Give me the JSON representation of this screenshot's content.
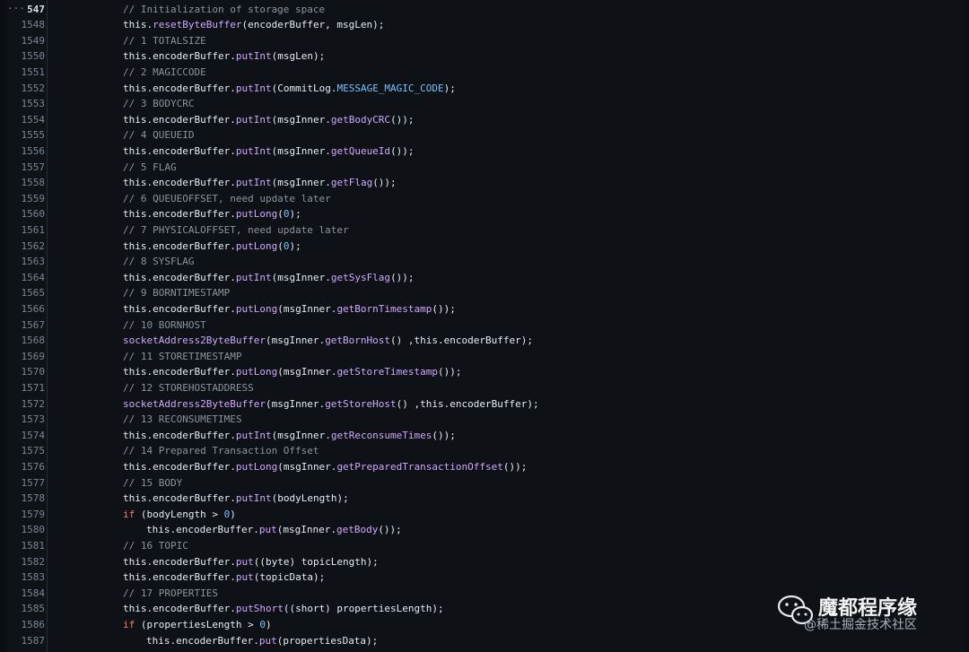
{
  "editor": {
    "fold_indicator": "···",
    "line_numbers": [
      "547",
      "1548",
      "1549",
      "1550",
      "1551",
      "1552",
      "1553",
      "1554",
      "1555",
      "1556",
      "1557",
      "1558",
      "1559",
      "1560",
      "1561",
      "1562",
      "1563",
      "1564",
      "1565",
      "1566",
      "1567",
      "1568",
      "1569",
      "1570",
      "1571",
      "1572",
      "1573",
      "1574",
      "1575",
      "1576",
      "1577",
      "1578",
      "1579",
      "1580",
      "1581",
      "1582",
      "1583",
      "1584",
      "1585",
      "1586",
      "1587"
    ],
    "active_line": "547",
    "lines": [
      {
        "indent": 0,
        "tokens": [
          {
            "t": "// Initialization of storage space",
            "c": "comment"
          }
        ]
      },
      {
        "indent": 0,
        "tokens": [
          {
            "t": "this.",
            "c": "plain"
          },
          {
            "t": "resetByteBuffer",
            "c": "method"
          },
          {
            "t": "(encoderBuffer, msgLen);",
            "c": "plain"
          }
        ]
      },
      {
        "indent": 0,
        "tokens": [
          {
            "t": "// 1 TOTALSIZE",
            "c": "comment"
          }
        ]
      },
      {
        "indent": 0,
        "tokens": [
          {
            "t": "this.encoderBuffer.",
            "c": "plain"
          },
          {
            "t": "putInt",
            "c": "method"
          },
          {
            "t": "(msgLen);",
            "c": "plain"
          }
        ]
      },
      {
        "indent": 0,
        "tokens": [
          {
            "t": "// 2 MAGICCODE",
            "c": "comment"
          }
        ]
      },
      {
        "indent": 0,
        "tokens": [
          {
            "t": "this.encoderBuffer.",
            "c": "plain"
          },
          {
            "t": "putInt",
            "c": "method"
          },
          {
            "t": "(CommitLog.",
            "c": "plain"
          },
          {
            "t": "MESSAGE_MAGIC_CODE",
            "c": "const"
          },
          {
            "t": ");",
            "c": "plain"
          }
        ]
      },
      {
        "indent": 0,
        "tokens": [
          {
            "t": "// 3 BODYCRC",
            "c": "comment"
          }
        ]
      },
      {
        "indent": 0,
        "tokens": [
          {
            "t": "this.encoderBuffer.",
            "c": "plain"
          },
          {
            "t": "putInt",
            "c": "method"
          },
          {
            "t": "(msgInner.",
            "c": "plain"
          },
          {
            "t": "getBodyCRC",
            "c": "method"
          },
          {
            "t": "());",
            "c": "plain"
          }
        ]
      },
      {
        "indent": 0,
        "tokens": [
          {
            "t": "// 4 QUEUEID",
            "c": "comment"
          }
        ]
      },
      {
        "indent": 0,
        "tokens": [
          {
            "t": "this.encoderBuffer.",
            "c": "plain"
          },
          {
            "t": "putInt",
            "c": "method"
          },
          {
            "t": "(msgInner.",
            "c": "plain"
          },
          {
            "t": "getQueueId",
            "c": "method"
          },
          {
            "t": "());",
            "c": "plain"
          }
        ]
      },
      {
        "indent": 0,
        "tokens": [
          {
            "t": "// 5 FLAG",
            "c": "comment"
          }
        ]
      },
      {
        "indent": 0,
        "tokens": [
          {
            "t": "this.encoderBuffer.",
            "c": "plain"
          },
          {
            "t": "putInt",
            "c": "method"
          },
          {
            "t": "(msgInner.",
            "c": "plain"
          },
          {
            "t": "getFlag",
            "c": "method"
          },
          {
            "t": "());",
            "c": "plain"
          }
        ]
      },
      {
        "indent": 0,
        "tokens": [
          {
            "t": "// 6 QUEUEOFFSET, need update later",
            "c": "comment"
          }
        ]
      },
      {
        "indent": 0,
        "tokens": [
          {
            "t": "this.encoderBuffer.",
            "c": "plain"
          },
          {
            "t": "putLong",
            "c": "method"
          },
          {
            "t": "(",
            "c": "plain"
          },
          {
            "t": "0",
            "c": "num"
          },
          {
            "t": ");",
            "c": "plain"
          }
        ]
      },
      {
        "indent": 0,
        "tokens": [
          {
            "t": "// 7 PHYSICALOFFSET, need update later",
            "c": "comment"
          }
        ]
      },
      {
        "indent": 0,
        "tokens": [
          {
            "t": "this.encoderBuffer.",
            "c": "plain"
          },
          {
            "t": "putLong",
            "c": "method"
          },
          {
            "t": "(",
            "c": "plain"
          },
          {
            "t": "0",
            "c": "num"
          },
          {
            "t": ");",
            "c": "plain"
          }
        ]
      },
      {
        "indent": 0,
        "tokens": [
          {
            "t": "// 8 SYSFLAG",
            "c": "comment"
          }
        ]
      },
      {
        "indent": 0,
        "tokens": [
          {
            "t": "this.encoderBuffer.",
            "c": "plain"
          },
          {
            "t": "putInt",
            "c": "method"
          },
          {
            "t": "(msgInner.",
            "c": "plain"
          },
          {
            "t": "getSysFlag",
            "c": "method"
          },
          {
            "t": "());",
            "c": "plain"
          }
        ]
      },
      {
        "indent": 0,
        "tokens": [
          {
            "t": "// 9 BORNTIMESTAMP",
            "c": "comment"
          }
        ]
      },
      {
        "indent": 0,
        "tokens": [
          {
            "t": "this.encoderBuffer.",
            "c": "plain"
          },
          {
            "t": "putLong",
            "c": "method"
          },
          {
            "t": "(msgInner.",
            "c": "plain"
          },
          {
            "t": "getBornTimestamp",
            "c": "method"
          },
          {
            "t": "());",
            "c": "plain"
          }
        ]
      },
      {
        "indent": 0,
        "tokens": [
          {
            "t": "// 10 BORNHOST",
            "c": "comment"
          }
        ]
      },
      {
        "indent": 0,
        "tokens": [
          {
            "t": "socketAddress2ByteBuffer",
            "c": "method"
          },
          {
            "t": "(msgInner.",
            "c": "plain"
          },
          {
            "t": "getBornHost",
            "c": "method"
          },
          {
            "t": "() ,this.encoderBuffer);",
            "c": "plain"
          }
        ]
      },
      {
        "indent": 0,
        "tokens": [
          {
            "t": "// 11 STORETIMESTAMP",
            "c": "comment"
          }
        ]
      },
      {
        "indent": 0,
        "tokens": [
          {
            "t": "this.encoderBuffer.",
            "c": "plain"
          },
          {
            "t": "putLong",
            "c": "method"
          },
          {
            "t": "(msgInner.",
            "c": "plain"
          },
          {
            "t": "getStoreTimestamp",
            "c": "method"
          },
          {
            "t": "());",
            "c": "plain"
          }
        ]
      },
      {
        "indent": 0,
        "tokens": [
          {
            "t": "// 12 STOREHOSTADDRESS",
            "c": "comment"
          }
        ]
      },
      {
        "indent": 0,
        "tokens": [
          {
            "t": "socketAddress2ByteBuffer",
            "c": "method"
          },
          {
            "t": "(msgInner.",
            "c": "plain"
          },
          {
            "t": "getStoreHost",
            "c": "method"
          },
          {
            "t": "() ,this.encoderBuffer);",
            "c": "plain"
          }
        ]
      },
      {
        "indent": 0,
        "tokens": [
          {
            "t": "// 13 RECONSUMETIMES",
            "c": "comment"
          }
        ]
      },
      {
        "indent": 0,
        "tokens": [
          {
            "t": "this.encoderBuffer.",
            "c": "plain"
          },
          {
            "t": "putInt",
            "c": "method"
          },
          {
            "t": "(msgInner.",
            "c": "plain"
          },
          {
            "t": "getReconsumeTimes",
            "c": "method"
          },
          {
            "t": "());",
            "c": "plain"
          }
        ]
      },
      {
        "indent": 0,
        "tokens": [
          {
            "t": "// 14 Prepared Transaction Offset",
            "c": "comment"
          }
        ]
      },
      {
        "indent": 0,
        "tokens": [
          {
            "t": "this.encoderBuffer.",
            "c": "plain"
          },
          {
            "t": "putLong",
            "c": "method"
          },
          {
            "t": "(msgInner.",
            "c": "plain"
          },
          {
            "t": "getPreparedTransactionOffset",
            "c": "method"
          },
          {
            "t": "());",
            "c": "plain"
          }
        ]
      },
      {
        "indent": 0,
        "tokens": [
          {
            "t": "// 15 BODY",
            "c": "comment"
          }
        ]
      },
      {
        "indent": 0,
        "tokens": [
          {
            "t": "this.encoderBuffer.",
            "c": "plain"
          },
          {
            "t": "putInt",
            "c": "method"
          },
          {
            "t": "(bodyLength);",
            "c": "plain"
          }
        ]
      },
      {
        "indent": 0,
        "tokens": [
          {
            "t": "if",
            "c": "kw"
          },
          {
            "t": " (bodyLength > ",
            "c": "plain"
          },
          {
            "t": "0",
            "c": "num"
          },
          {
            "t": ")",
            "c": "plain"
          }
        ]
      },
      {
        "indent": 1,
        "tokens": [
          {
            "t": "this.encoderBuffer.",
            "c": "plain"
          },
          {
            "t": "put",
            "c": "method"
          },
          {
            "t": "(msgInner.",
            "c": "plain"
          },
          {
            "t": "getBody",
            "c": "method"
          },
          {
            "t": "());",
            "c": "plain"
          }
        ]
      },
      {
        "indent": 0,
        "tokens": [
          {
            "t": "// 16 TOPIC",
            "c": "comment"
          }
        ]
      },
      {
        "indent": 0,
        "tokens": [
          {
            "t": "this.encoderBuffer.",
            "c": "plain"
          },
          {
            "t": "put",
            "c": "method"
          },
          {
            "t": "((byte) topicLength);",
            "c": "plain"
          }
        ]
      },
      {
        "indent": 0,
        "tokens": [
          {
            "t": "this.encoderBuffer.",
            "c": "plain"
          },
          {
            "t": "put",
            "c": "method"
          },
          {
            "t": "(topicData);",
            "c": "plain"
          }
        ]
      },
      {
        "indent": 0,
        "tokens": [
          {
            "t": "// 17 PROPERTIES",
            "c": "comment"
          }
        ]
      },
      {
        "indent": 0,
        "tokens": [
          {
            "t": "this.encoderBuffer.",
            "c": "plain"
          },
          {
            "t": "putShort",
            "c": "method"
          },
          {
            "t": "((short) propertiesLength);",
            "c": "plain"
          }
        ]
      },
      {
        "indent": 0,
        "tokens": [
          {
            "t": "if",
            "c": "kw"
          },
          {
            "t": " (propertiesLength > ",
            "c": "plain"
          },
          {
            "t": "0",
            "c": "num"
          },
          {
            "t": ")",
            "c": "plain"
          }
        ]
      },
      {
        "indent": 1,
        "tokens": [
          {
            "t": "this.encoderBuffer.",
            "c": "plain"
          },
          {
            "t": "put",
            "c": "method"
          },
          {
            "t": "(propertiesData);",
            "c": "plain"
          }
        ]
      }
    ]
  },
  "watermark": {
    "title": "魔都程序缘",
    "subtitle": "@稀土掘金技术社区",
    "icon": "wechat-icon"
  },
  "colors": {
    "background": "#0e1116",
    "comment": "#8b949e",
    "method": "#d2a8ff",
    "const": "#79c0ff",
    "keyword": "#ff7b72",
    "plain": "#e6edf3"
  }
}
